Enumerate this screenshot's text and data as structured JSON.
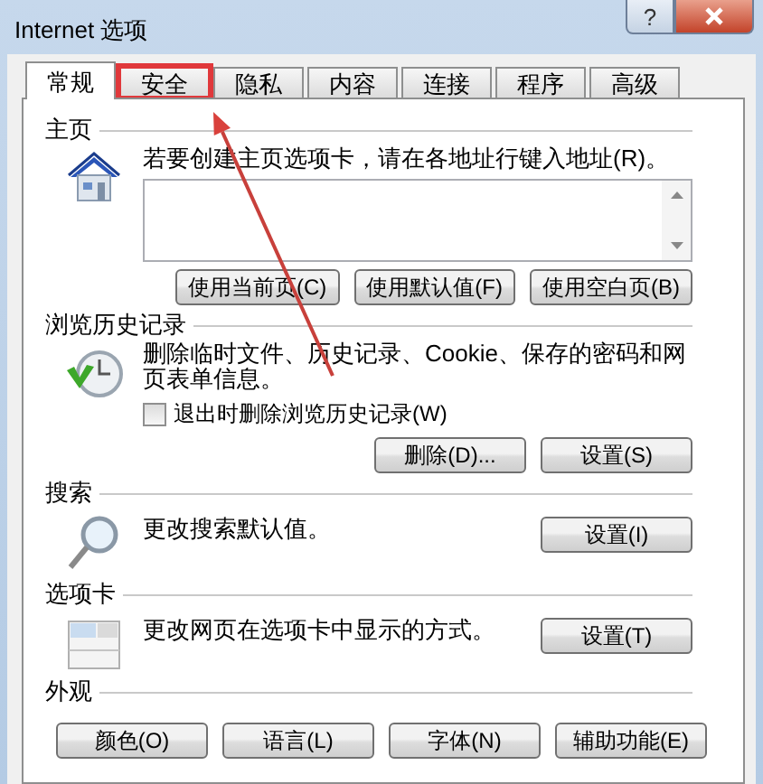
{
  "window": {
    "title": "Internet 选项",
    "help": "?"
  },
  "tabs": [
    {
      "label": "常规",
      "selected": true,
      "highlighted": false
    },
    {
      "label": "安全",
      "selected": false,
      "highlighted": true
    },
    {
      "label": "隐私",
      "selected": false,
      "highlighted": false
    },
    {
      "label": "内容",
      "selected": false,
      "highlighted": false
    },
    {
      "label": "连接",
      "selected": false,
      "highlighted": false
    },
    {
      "label": "程序",
      "selected": false,
      "highlighted": false
    },
    {
      "label": "高级",
      "selected": false,
      "highlighted": false
    }
  ],
  "sections": [
    {
      "kind": "homepage",
      "heading": "主页",
      "description": "若要创建主页选项卡，请在各地址行键入地址(R)。",
      "buttons": [
        "使用当前页(C)",
        "使用默认值(F)",
        "使用空白页(B)"
      ]
    },
    {
      "kind": "history",
      "heading": "浏览历史记录",
      "description": "删除临时文件、历史记录、Cookie、保存的密码和网页表单信息。",
      "checkbox": {
        "label": "退出时删除浏览历史记录(W)",
        "checked": false
      },
      "buttons": [
        "删除(D)...",
        "设置(S)"
      ]
    },
    {
      "kind": "search",
      "heading": "搜索",
      "description": "更改搜索默认值。",
      "buttons": [
        "设置(I)"
      ]
    },
    {
      "kind": "tabs",
      "heading": "选项卡",
      "description": "更改网页在选项卡中显示的方式。",
      "buttons": [
        "设置(T)"
      ]
    },
    {
      "kind": "appearance",
      "heading": "外观",
      "buttons": [
        "颜色(O)",
        "语言(L)",
        "字体(N)",
        "辅助功能(E)"
      ]
    }
  ]
}
